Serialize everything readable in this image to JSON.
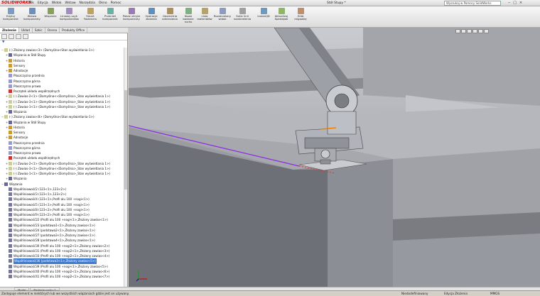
{
  "app": {
    "logo": "SOLIDWORKS",
    "menu": [
      "Plik",
      "Edycja",
      "Widok",
      "Wstaw",
      "Narzędzia",
      "Okno",
      "Pomoc"
    ],
    "document_title": "Stół Stupy *",
    "help_search_placeholder": "Wyszukaj w Pomocy SolidWorks"
  },
  "ribbon": [
    "Edytuj komponent",
    "Wstaw komponenty",
    "Wiązanie",
    "Liniowy szyk komponentów",
    "Smart Fasteners",
    "Przenieś komponent",
    "Pokaż ukryte komponenty",
    "Operacje złożenia",
    "Geometria odniesienia",
    "Nowe badanie ruchu",
    "Lista materiałów",
    "Rozstrzelony widok",
    "Szkic linii rozstrzelenia",
    "InstantJD",
    "Aktualizuj Speedpak",
    "Zrób migawkę"
  ],
  "panel_tabs": [
    "Złożenie",
    "Układ",
    "Szkic",
    "Ocena",
    "Produkty Office"
  ],
  "tree": [
    {
      "level": 0,
      "toggle": "−",
      "text": "(-) Złożony zawias<3> (Domyślna<Stan wyświetlania-1>)",
      "icon": "#cc9"
    },
    {
      "level": 1,
      "toggle": "+",
      "text": "Wiązania w Stół Stupy",
      "icon": "#669"
    },
    {
      "level": 1,
      "toggle": "+",
      "text": "Historia",
      "icon": "#c93"
    },
    {
      "level": 1,
      "toggle": "",
      "text": "Sensory",
      "icon": "#c93"
    },
    {
      "level": 1,
      "toggle": "+",
      "text": "Adnotacje",
      "icon": "#c93"
    },
    {
      "level": 1,
      "toggle": "",
      "text": "Płaszczyzna przednia",
      "icon": "#99c"
    },
    {
      "level": 1,
      "toggle": "",
      "text": "Płaszczyzna górna",
      "icon": "#99c"
    },
    {
      "level": 1,
      "toggle": "",
      "text": "Płaszczyzna prawa",
      "icon": "#99c"
    },
    {
      "level": 1,
      "toggle": "",
      "text": "Początek układu współrzędnych",
      "icon": "#c33"
    },
    {
      "level": 1,
      "toggle": "+",
      "text": "(-) Zawias-2<1> (Domyślna<<Domyślna>_Stan wyświetlania 1>)",
      "icon": "#cc9"
    },
    {
      "level": 1,
      "toggle": "+",
      "text": "(-) Zawias-3<1> (Domyślna<<Domyślna>_Stan wyświetlania 1>)",
      "icon": "#cc9"
    },
    {
      "level": 1,
      "toggle": "+",
      "text": "(-) Zawias-1<1> (Domyślna<<Domyślna>_Stan wyświetlania 1>)",
      "icon": "#cc9"
    },
    {
      "level": 1,
      "toggle": "+",
      "text": "Wiązania",
      "icon": "#669"
    },
    {
      "level": 0,
      "toggle": "−",
      "text": "(-) Złożony zawias<8> (Domyślna<Stan wyświetlania-1>)",
      "icon": "#cc9"
    },
    {
      "level": 1,
      "toggle": "+",
      "text": "Wiązania w Stół Stupy",
      "icon": "#669"
    },
    {
      "level": 1,
      "toggle": "+",
      "text": "Historia",
      "icon": "#c93"
    },
    {
      "level": 1,
      "toggle": "",
      "text": "Sensory",
      "icon": "#c93"
    },
    {
      "level": 1,
      "toggle": "+",
      "text": "Adnotacje",
      "icon": "#c93"
    },
    {
      "level": 1,
      "toggle": "",
      "text": "Płaszczyzna przednia",
      "icon": "#99c"
    },
    {
      "level": 1,
      "toggle": "",
      "text": "Płaszczyzna górna",
      "icon": "#99c"
    },
    {
      "level": 1,
      "toggle": "",
      "text": "Płaszczyzna prawa",
      "icon": "#99c"
    },
    {
      "level": 1,
      "toggle": "",
      "text": "Początek układu współrzędnych",
      "icon": "#c33"
    },
    {
      "level": 1,
      "toggle": "+",
      "text": "(-) Zawias-2<1> (Domyślna<<Domyślna>_Stan wyświetlania 1>)",
      "icon": "#cc9"
    },
    {
      "level": 1,
      "toggle": "+",
      "text": "(-) Zawias-3<1> (Domyślna<<Domyślna>_Stan wyświetlania 1>)",
      "icon": "#cc9"
    },
    {
      "level": 1,
      "toggle": "+",
      "text": "(-) Zawias-1<1> (Domyślna<<Domyślna>_Stan wyświetlania 1>)",
      "icon": "#cc9"
    },
    {
      "level": 1,
      "toggle": "+",
      "text": "Wiązania",
      "icon": "#669"
    },
    {
      "level": 0,
      "toggle": "−",
      "text": "Wiązania",
      "icon": "#669"
    },
    {
      "level": 1,
      "toggle": "",
      "text": "Współliniowość2 (123<1>,123<2>)",
      "icon": "#779"
    },
    {
      "level": 1,
      "toggle": "",
      "text": "Współliniowość3 (123<1>,123<2>)",
      "icon": "#779"
    },
    {
      "level": 1,
      "toggle": "",
      "text": "Współliniowość4 (123<1>,Profil alu 100 +nogi<1>)",
      "icon": "#779"
    },
    {
      "level": 1,
      "toggle": "",
      "text": "Współliniowość5 (123<1>,Profil alu 100 +nogi<1>)",
      "icon": "#779"
    },
    {
      "level": 1,
      "toggle": "",
      "text": "Współliniowość8 (123<2>,Profil alu 100 +nogi<1>)",
      "icon": "#779"
    },
    {
      "level": 1,
      "toggle": "",
      "text": "Współliniowość9 (123<2>,Profil alu 100 +nogi<1>)",
      "icon": "#779"
    },
    {
      "level": 1,
      "toggle": "",
      "text": "Współliniowość22 (Profil alu 100 +nogi<1>,Złożony zawias<1>)",
      "icon": "#779"
    },
    {
      "level": 1,
      "toggle": "",
      "text": "Współliniowość23 (podstawa1<1>,Złożony zawias<1>)",
      "icon": "#779"
    },
    {
      "level": 1,
      "toggle": "",
      "text": "Współliniowość24 (podstawa2<1>,Złożony zawias<1>)",
      "icon": "#779"
    },
    {
      "level": 1,
      "toggle": "",
      "text": "Współliniowość27 (podstawa3<1>,Złożony zawias<1>)",
      "icon": "#779"
    },
    {
      "level": 1,
      "toggle": "",
      "text": "Współliniowość28 (podstawa4<1>,Złożony zawias<1>)",
      "icon": "#779"
    },
    {
      "level": 1,
      "toggle": "",
      "text": "Współliniowość30 (Profil alu 100 +nogi2<1>,Złożony zawias<2>)",
      "icon": "#779"
    },
    {
      "level": 1,
      "toggle": "",
      "text": "Współliniowość31 (Profil alu 100 +nogi2<1>,Złożony zawias<3>)",
      "icon": "#779"
    },
    {
      "level": 1,
      "toggle": "",
      "text": "Współliniowość33 (Profil alu 100 +nogi2<1>,Złożony zawias<4>)",
      "icon": "#779"
    },
    {
      "level": 1,
      "toggle": "",
      "text": "Współliniowość36 (podstawa3<1>,Złożony zawias<5>)",
      "icon": "#779",
      "selected": true
    },
    {
      "level": 1,
      "toggle": "",
      "text": "Współliniowość39 (Profil alu 100 +nogi<1>,Złożony zawias<5>)",
      "icon": "#779"
    },
    {
      "level": 1,
      "toggle": "",
      "text": "Współliniowość40 (Profil alu 100 +nogi2<1>,Złożony zawias<6>)",
      "icon": "#779"
    },
    {
      "level": 1,
      "toggle": "",
      "text": "Współliniowość41 (Profil alu 100 +nogi2<1>,Złożony zawias<7>)",
      "icon": "#779"
    }
  ],
  "bottom_tabs": [
    "Model",
    "Badanie ruchu 1"
  ],
  "status": {
    "message": "Zastępuje element w niektórych lub we wszystkich wiązaniach gdzie jest on używany.",
    "state": "Niedodefiniowany",
    "mode": "Edycja Złożenia",
    "units": "MMGS"
  }
}
